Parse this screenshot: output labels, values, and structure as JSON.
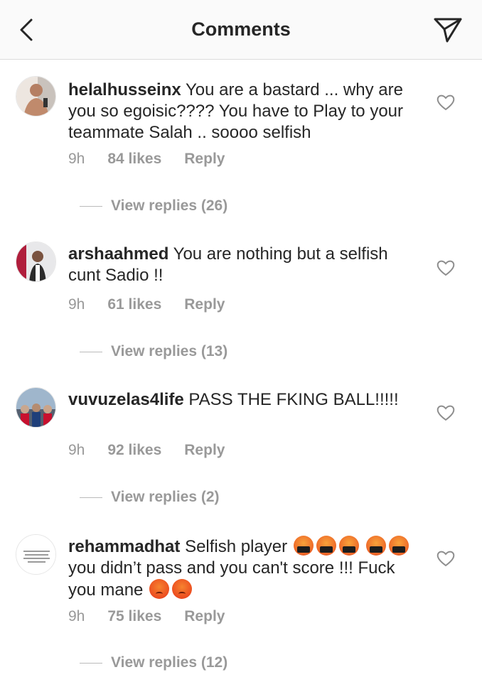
{
  "header": {
    "title": "Comments",
    "back_icon": "chevron-left-icon",
    "share_icon": "paper-plane-icon"
  },
  "comments": [
    {
      "username": "helalhusseinx",
      "text": "You are a bastard ... why are you so egoisic???? You have to Play to your teammate Salah .. soooo selfish",
      "time": "9h",
      "likes": "84 likes",
      "reply": "Reply",
      "view_replies": "View replies (26)"
    },
    {
      "username": "arshaahmed",
      "text": "You are nothing but a selfish cunt Sadio !!",
      "time": "9h",
      "likes": "61 likes",
      "reply": "Reply",
      "view_replies": "View replies (13)"
    },
    {
      "username": "vuvuzelas4life",
      "text": "PASS THE FKING BALL!!!!!",
      "time": "9h",
      "likes": "92 likes",
      "reply": "Reply",
      "view_replies": "View replies (2)"
    },
    {
      "username": "rehammadhat",
      "text_part1": "Selfish player",
      "text_part2": "you didn’t pass and you can't score !!! Fuck you mane",
      "emoji_cursing": "face-with-symbols-on-mouth",
      "emoji_angry": "pouting-face",
      "avatar_text": "Maybe you should look at how you're treating me before you blah about how I used to it",
      "time": "9h",
      "likes": "75 likes",
      "reply": "Reply",
      "view_replies": "View replies (12)"
    }
  ],
  "colors": {
    "text": "#262626",
    "muted": "#999999",
    "header_bg": "#fafafa"
  }
}
